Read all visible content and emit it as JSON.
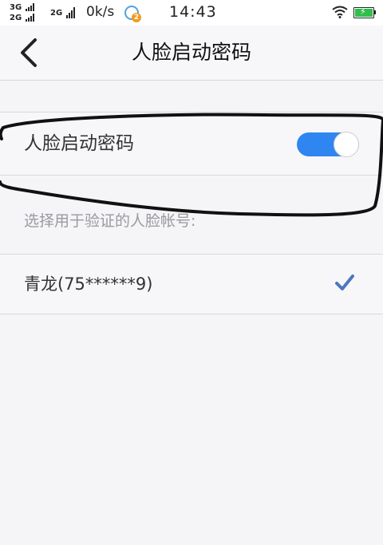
{
  "status_bar": {
    "network_top": "3G",
    "network_bottom": "2G",
    "network_mid": "2G",
    "speed": "0k/s",
    "notification_badge": "2",
    "time": "14:43"
  },
  "nav": {
    "title": "人脸启动密码"
  },
  "face_unlock": {
    "label": "人脸启动密码",
    "enabled": true
  },
  "hint": "选择用于验证的人脸帐号:",
  "account": {
    "label": "青龙(75******9)",
    "selected": true
  },
  "colors": {
    "toggle_on": "#2f86f0",
    "check": "#4a78c0",
    "annotation": "#111111"
  }
}
